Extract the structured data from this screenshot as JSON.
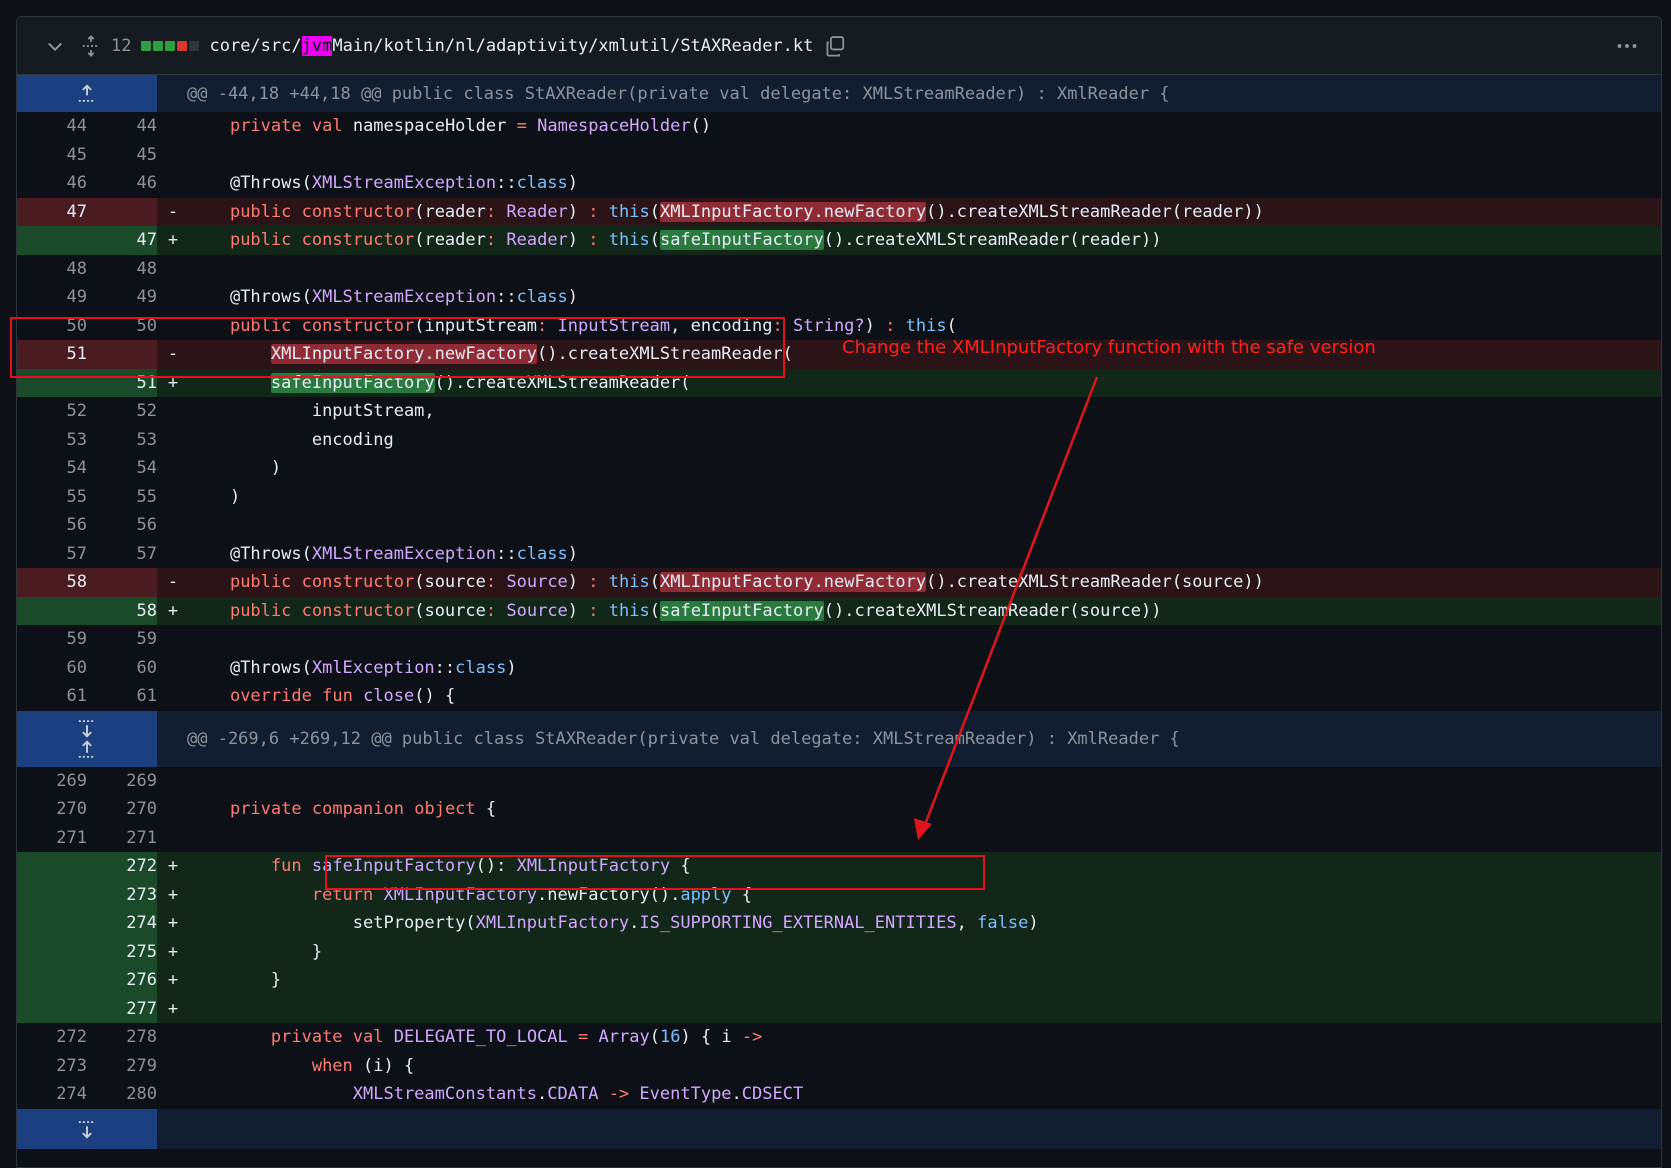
{
  "header": {
    "change_count": "12",
    "path_prefix": "core/src/",
    "path_highlight": "jvm",
    "path_suffix": "Main/kotlin/nl/adaptivity/xmlutil/StAXReader.kt",
    "diffstat_colors": [
      "#2ea043",
      "#2ea043",
      "#2ea043",
      "#da3633",
      "#30363d"
    ]
  },
  "hunks": [
    "@@ -44,18 +44,18 @@ public class StAXReader(private val delegate: XMLStreamReader) : XmlReader {",
    "@@ -269,6 +269,12 @@ public class StAXReader(private val delegate: XMLStreamReader) : XmlReader {"
  ],
  "line_numbers": {
    "l44": "44",
    "l45": "45",
    "l46": "46",
    "l47": "47",
    "l48": "48",
    "l49": "49",
    "l50": "50",
    "l51": "51",
    "l52": "52",
    "l53": "53",
    "l54": "54",
    "l55": "55",
    "l56": "56",
    "l57": "57",
    "l58": "58",
    "l59": "59",
    "l60": "60",
    "l61": "61",
    "l269": "269",
    "l270": "270",
    "l271": "271",
    "l272": "272",
    "l273": "273",
    "l274": "274",
    "l275": "275",
    "l276": "276",
    "l277": "277",
    "l278": "278",
    "l279": "279",
    "l280": "280"
  },
  "signs": {
    "minus": "-",
    "plus": "+"
  },
  "tokens": {
    "private": "private",
    "val": "val",
    "public": "public",
    "constructor": "constructor",
    "this": "this",
    "override": "override",
    "fun": "fun",
    "return": "return",
    "companion": "companion",
    "object": "object",
    "when": "when",
    "apply": "apply",
    "false": "false",
    "class": "class",
    "colon": ":",
    "arrow": "->",
    "eq": "=",
    "namespaceHolder": "namespaceHolder",
    "NamespaceHolder": "NamespaceHolder",
    "parens": "()",
    "throws": "@Throws(",
    "XMLStreamException": "XMLStreamException",
    "coloncolon": "::",
    "close_paren": ")",
    "reader_param": "(reader",
    "Reader": "Reader",
    "close_sp": ") ",
    "open_paren": "(",
    "XMLInputFactory_newFactory": "XMLInputFactory.newFactory",
    "createReader": "().createXMLStreamReader(reader))",
    "safeInputFactory": "safeInputFactory",
    "inputStream_param": "(inputStream",
    "InputStream": "InputStream",
    "encoding_param": ", encoding",
    "String": "String?",
    "createOpen": "().createXMLStreamReader(",
    "inputStream": "inputStream,",
    "encoding": "encoding",
    "source_param": "(source",
    "Source": "Source",
    "createSource": "().createXMLStreamReader(source))",
    "XmlException": "XmlException",
    "close": "close",
    "brace_open": "() {",
    "brace": "{",
    "brace_close": "}",
    "safeFn": "safeInputFactory",
    "XMLInputFactory": "XMLInputFactory",
    "newFactory": ".newFactory().",
    "apply_brace": " {",
    "setProperty": "setProperty(",
    "dot": ".",
    "IS_SUPPORTING": "IS_SUPPORTING_EXTERNAL_ENTITIES",
    "comma": ", ",
    "DELEGATE_TO_LOCAL": "DELEGATE_TO_LOCAL",
    "Array": "Array",
    "sixteen": "16",
    "lambda": ") { i ",
    "when_i": " (i) {",
    "XMLStreamConstants": "XMLStreamConstants",
    "CDATA": "CDATA",
    "EventType": "EventType",
    "CDSECT": "CDSECT",
    "paren_colon": "(): "
  },
  "annotation": "Change the XMLInputFactory function with the safe version"
}
